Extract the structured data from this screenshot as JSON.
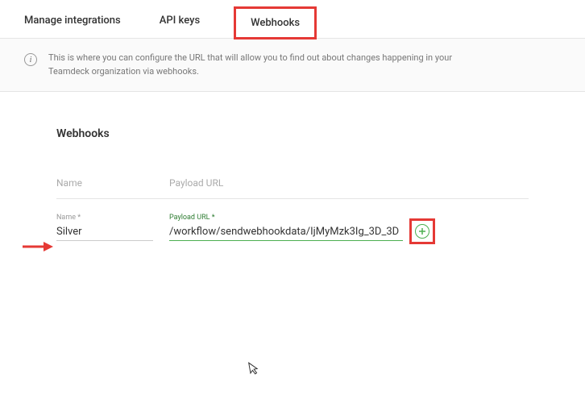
{
  "tabs": {
    "manage": "Manage integrations",
    "apikeys": "API keys",
    "webhooks": "Webhooks"
  },
  "info": {
    "text": "This is where you can configure the URL that will allow you to find out about changes happening in your Teamdeck organization via webhooks."
  },
  "section": {
    "title": "Webhooks",
    "headers": {
      "name": "Name",
      "url": "Payload URL"
    },
    "form": {
      "name_label": "Name *",
      "url_label": "Payload URL *",
      "name_value": "Silver",
      "url_value": "/workflow/sendwebhookdata/IjMyMzk3Ig_3D_3D"
    }
  },
  "colors": {
    "highlight": "#e53935",
    "accent": "#4caf50"
  }
}
